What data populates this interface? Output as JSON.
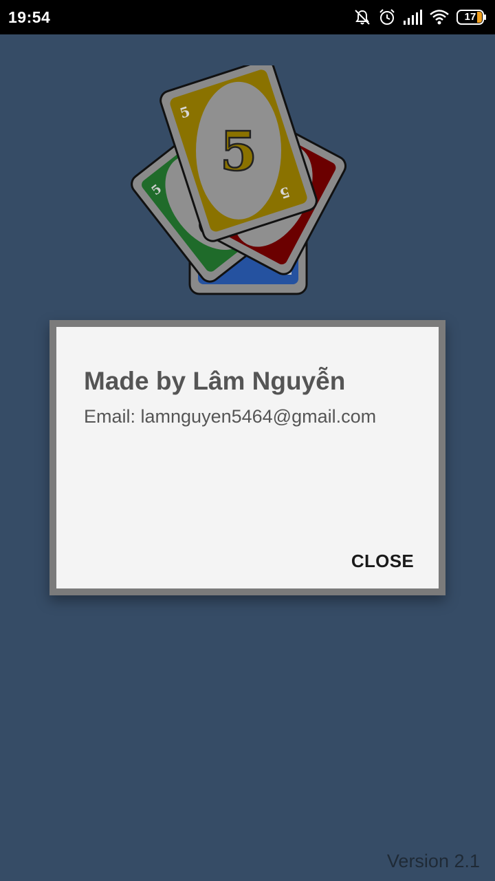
{
  "status_bar": {
    "time": "19:54",
    "battery_level": "17",
    "icons": [
      "mute-icon",
      "alarm-icon",
      "signal-icon",
      "wifi-icon",
      "battery-icon"
    ]
  },
  "logo": {
    "card_number": "5",
    "card_colors": {
      "green": "#1f6b2a",
      "yellow": "#8a7200",
      "red": "#6b0000",
      "blue": "#2552a0"
    }
  },
  "dialog": {
    "title": "Made by Lâm Nguyễn",
    "email": "Email: lamnguyen5464@gmail.com",
    "close_label": "CLOSE"
  },
  "footer": {
    "version": "Version 2.1"
  },
  "colors": {
    "background": "#364c66",
    "dialog_frame": "#7b7b7b",
    "dialog_body": "#f4f4f4"
  }
}
